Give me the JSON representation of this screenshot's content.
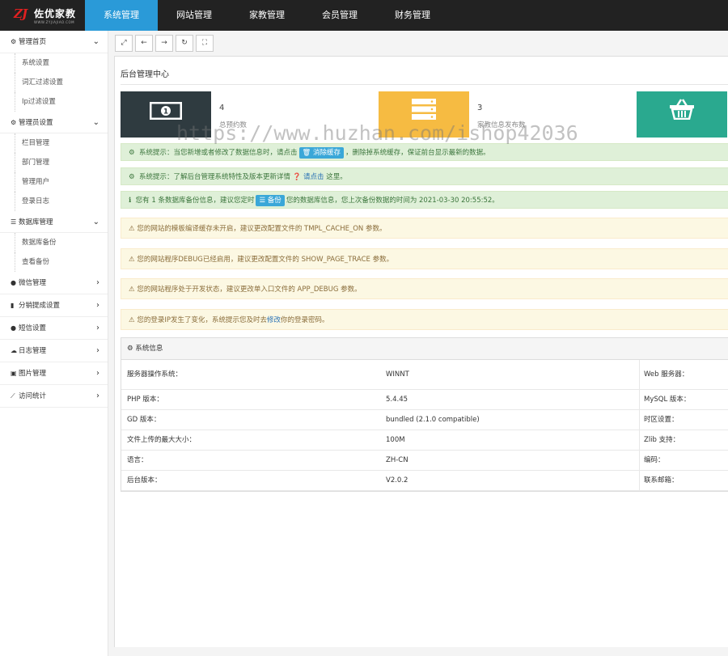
{
  "brand": {
    "name": "佐优家教",
    "url_text": "WWW.ZYJIAJIAO.COM",
    "mark": "ZJ"
  },
  "colors": {
    "topbar": "#222222",
    "accent": "#2a9ad8",
    "stat1": "#2f3b40",
    "stat2": "#f6bb42",
    "stat3": "#2aa98f"
  },
  "nav": [
    "系统管理",
    "网站管理",
    "家教管理",
    "会员管理",
    "财务管理"
  ],
  "sidebar": {
    "groups": [
      {
        "label": "管理首页",
        "icon": "gears-icon",
        "items": [
          "系统设置",
          "词汇过滤设置",
          "Ip过滤设置"
        ]
      },
      {
        "label": "管理员设置",
        "icon": "gear-icon",
        "items": [
          "栏目管理",
          "部门管理",
          "管理用户",
          "登录日志"
        ]
      },
      {
        "label": "数据库管理",
        "icon": "database-icon",
        "items": [
          "数据库备份",
          "查看备份"
        ]
      },
      {
        "label": "微信管理",
        "icon": "wechat-icon",
        "items": []
      },
      {
        "label": "分销提成设置",
        "icon": "bar-chart-icon",
        "items": []
      },
      {
        "label": "短信设置",
        "icon": "comment-icon",
        "items": []
      },
      {
        "label": "日志管理",
        "icon": "cloud-icon",
        "items": []
      },
      {
        "label": "图片管理",
        "icon": "image-icon",
        "items": []
      },
      {
        "label": "访问统计",
        "icon": "line-chart-icon",
        "items": []
      }
    ]
  },
  "page": {
    "title": "后台管理中心"
  },
  "stats": [
    {
      "value": "4",
      "label": "总预约数",
      "icon": "money-icon"
    },
    {
      "value": "3",
      "label": "家教信息发布数",
      "icon": "server-icon"
    },
    {
      "value": "",
      "label": "",
      "icon": "basket-icon"
    }
  ],
  "alerts": {
    "a1_pre": "系统提示：当您新增或者修改了数据信息时，请点击",
    "a1_btn": "消除缓存",
    "a1_post": "，删除掉系统缓存，保证前台显示最新的数据。",
    "a2_pre": "系统提示：了解后台管理系统特性及版本更新详情",
    "a2_link": "请点击",
    "a2_post": "这里。",
    "a3_pre": "您有 1 条数据库备份信息，建议您定时",
    "a3_btn": "备份",
    "a3_post": "您的数据库信息，您上次备份数据的时间为 2021-03-30 20:55:52。",
    "w1": "您的网站的模板编译缓存未开启，建议更改配置文件的 TMPL_CACHE_ON 参数。",
    "w2": "您的网站程序DEBUG已经启用，建议更改配置文件的 SHOW_PAGE_TRACE 参数。",
    "w3": "您的网站程序处于开发状态，建议更改单入口文件的 APP_DEBUG 参数。",
    "w4_pre": "您的登录IP发生了变化，系统提示您及时去",
    "w4_link": "修改",
    "w4_post": "你的登录密码。"
  },
  "sysinfo": {
    "title": "系统信息",
    "rows": [
      [
        "服务器操作系统：",
        "WINNT",
        "Web 服务器："
      ],
      [
        "PHP 版本：",
        "5.4.45",
        "MySQL 版本："
      ],
      [
        "GD 版本：",
        "bundled (2.1.0 compatible)",
        "时区设置："
      ],
      [
        "文件上传的最大大小：",
        "100M",
        "Zlib 支持："
      ],
      [
        "语言：",
        "ZH-CN",
        "编码："
      ],
      [
        "后台版本：",
        "V2.0.2",
        "联系邮箱："
      ]
    ]
  },
  "watermark": "https://www.huzhan.com/ishop42036"
}
